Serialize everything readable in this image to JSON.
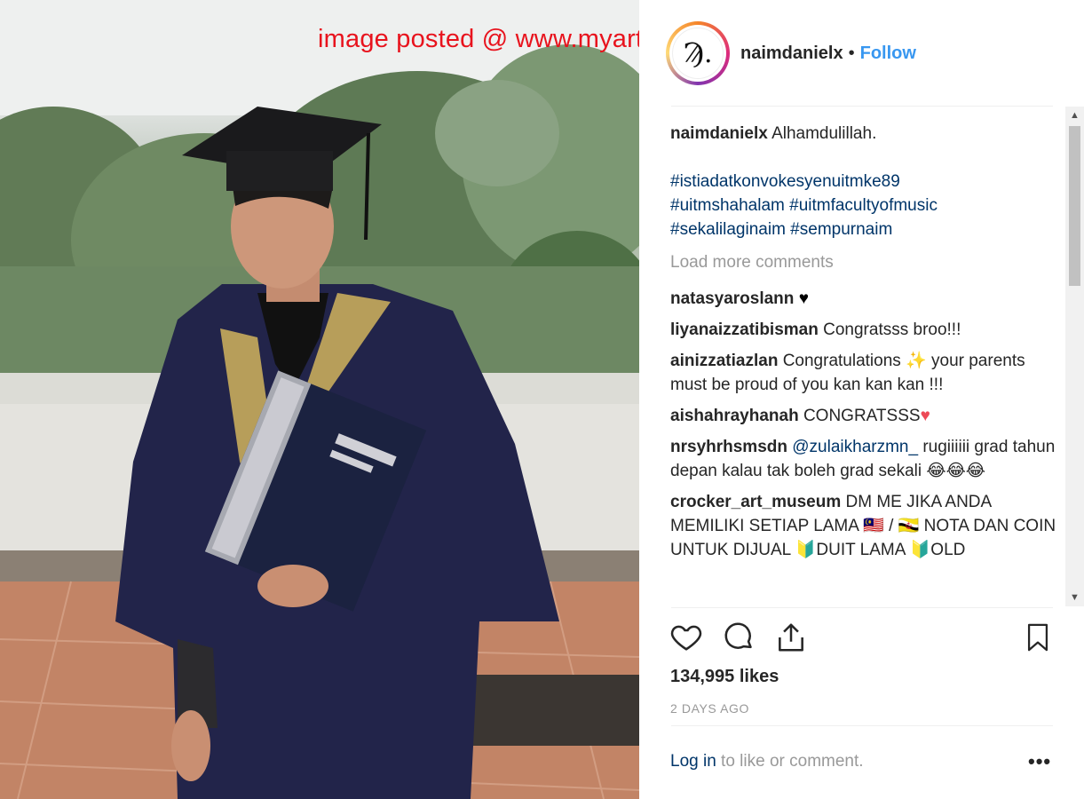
{
  "watermark": "image posted @ www.myartis.com",
  "post": {
    "avatar_text": "Ϡ.",
    "username": "naimdanielx",
    "separator": "•",
    "follow_label": "Follow"
  },
  "caption": {
    "user": "naimdanielx",
    "text": "Alhamdulillah.",
    "hashtags": [
      "#istiadatkonvokesyenuitmke89",
      "#uitmshahalam #uitmfacultyofmusic",
      "#sekalilaginaim #sempurnaim"
    ]
  },
  "load_more": "Load more comments",
  "comments": [
    {
      "user": "natasyaroslann",
      "text": "♥"
    },
    {
      "user": "liyanaizzatibisman",
      "text": "Congratsss broo!!!"
    },
    {
      "user": "ainizzatiazlan",
      "text": "Congratulations ✨ your parents must be proud of you kan kan kan !!!"
    },
    {
      "user": "aishahrayhanah",
      "text": "CONGRATSSS",
      "emoji": "♥"
    },
    {
      "user": "nrsyhrhsmsdn",
      "mention": "@zulaikharzmn_",
      "text": "rugiiiiii grad tahun depan kalau tak boleh grad sekali 😂😂😂"
    },
    {
      "user": "crocker_art_museum",
      "text": "DM ME JIKA ANDA MEMILIKI SETIAP LAMA 🇲🇾 / 🇧🇳 NOTA DAN COIN UNTUK DIJUAL 🔰DUIT LAMA 🔰OLD"
    }
  ],
  "likes": "134,995 likes",
  "time_ago": "2 DAYS AGO",
  "footer": {
    "login_link": "Log in",
    "login_rest": " to like or comment.",
    "more": "•••"
  },
  "icons": [
    "heart-icon",
    "comment-icon",
    "share-icon",
    "bookmark-icon"
  ],
  "colors": {
    "accent": "#3897f0",
    "hashtag": "#003569",
    "muted": "#999999",
    "watermark": "#e8131d"
  }
}
